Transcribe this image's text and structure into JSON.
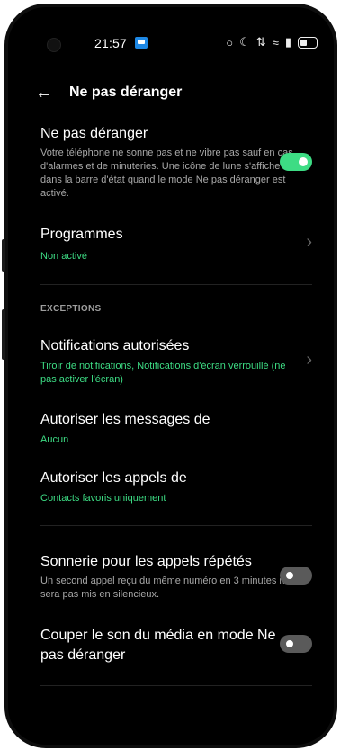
{
  "status_bar": {
    "time": "21:57",
    "icons": [
      "alarm-icon",
      "moon-icon",
      "data-icon",
      "wifi-icon",
      "signal-icon",
      "battery-icon"
    ]
  },
  "header": {
    "back_icon": "←",
    "title": "Ne pas déranger"
  },
  "dnd": {
    "title": "Ne pas déranger",
    "description": "Votre téléphone ne sonne pas et ne vibre pas sauf en cas d'alarmes et de minuteries. Une icône de lune s'affiche dans la barre d'état quand le mode Ne pas déranger est activé.",
    "enabled": true
  },
  "schedules": {
    "title": "Programmes",
    "status": "Non activé"
  },
  "exceptions": {
    "section_label": "EXCEPTIONS",
    "notifications": {
      "title": "Notifications autorisées",
      "value": "Tiroir de notifications, Notifications d'écran verrouillé (ne pas activer l'écran)"
    },
    "messages": {
      "title": "Autoriser les messages de",
      "value": "Aucun"
    },
    "calls": {
      "title": "Autoriser les appels de",
      "value": "Contacts favoris uniquement"
    }
  },
  "repeat_calls": {
    "title": "Sonnerie pour les appels répétés",
    "description": "Un second appel reçu du même numéro en 3 minutes ne sera pas mis en silencieux.",
    "enabled": false
  },
  "mute_media": {
    "title": "Couper le son du média en mode Ne pas déranger",
    "enabled": false
  },
  "colors": {
    "accent": "#3ddc84",
    "background": "#000000"
  }
}
